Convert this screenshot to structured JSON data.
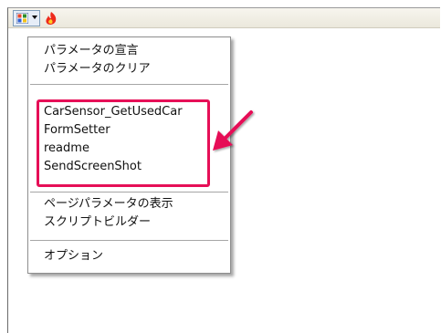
{
  "toolbar": {
    "menu_button_icon": "colored-grid-icon",
    "dropdown_icon": "chevron-down-icon",
    "app_icon": "flame-icon"
  },
  "menu": {
    "group1": [
      "パラメータの宣言",
      "パラメータのクリア"
    ],
    "group2": [
      "CarSensor_GetUsedCar",
      "FormSetter",
      "readme",
      "SendScreenShot"
    ],
    "group3": [
      "ページパラメータの表示",
      "スクリプトビルダー"
    ],
    "group4": [
      "オプション"
    ]
  },
  "annotation": {
    "highlight_color": "#e60f57",
    "arrow_color": "#e60f57"
  }
}
